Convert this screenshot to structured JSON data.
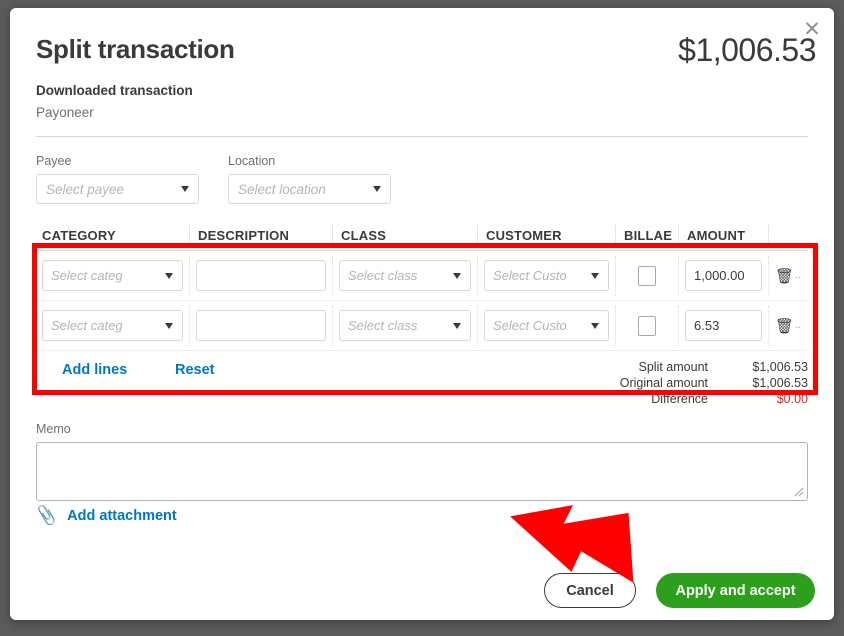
{
  "modal": {
    "title": "Split transaction",
    "total_amount": "$1,006.53",
    "close_icon": "close-icon",
    "downloaded_label": "Downloaded transaction",
    "downloaded_value": "Payoneer"
  },
  "fields": {
    "payee": {
      "label": "Payee",
      "placeholder": "Select payee",
      "value": ""
    },
    "location": {
      "label": "Location",
      "placeholder": "Select location",
      "value": ""
    }
  },
  "table": {
    "headers": [
      "CATEGORY",
      "DESCRIPTION",
      "CLASS",
      "CUSTOMER",
      "BILLAE",
      "AMOUNT",
      ""
    ],
    "placeholders": {
      "category": "Select categ",
      "description": "",
      "class": "Select class",
      "customer": "Select Custo"
    },
    "rows": [
      {
        "category": "",
        "description": "",
        "class": "",
        "customer": "",
        "billable": false,
        "amount": "1,000.00",
        "delete_icon": "trash-icon",
        "delete_more": ".."
      },
      {
        "category": "",
        "description": "",
        "class": "",
        "customer": "",
        "billable": false,
        "amount": "6.53",
        "delete_icon": "trash-icon",
        "delete_more": ".."
      }
    ]
  },
  "actions": {
    "add_lines": "Add lines",
    "reset": "Reset"
  },
  "totals": [
    {
      "label": "Split amount",
      "value": "$1,006.53",
      "negative": false
    },
    {
      "label": "Original amount",
      "value": "$1,006.53",
      "negative": false
    },
    {
      "label": "Difference",
      "value": "$0.00",
      "negative": true
    }
  ],
  "memo": {
    "label": "Memo",
    "value": "",
    "placeholder": ""
  },
  "attachment": {
    "label": "Add attachment",
    "icon": "paperclip-icon"
  },
  "footer": {
    "cancel": "Cancel",
    "apply": "Apply and accept"
  },
  "annotations": {
    "highlight_rect_color": "#ff0000",
    "arrow_color": "#ff0000"
  },
  "background": {
    "ghost_char": "c"
  },
  "colors": {
    "accent_link": "#0077c5",
    "primary_button": "#2ca01c",
    "text": "#393a3d",
    "muted": "#6b6f76",
    "negative": "#d52b1e",
    "backdrop": "#5c5c5c"
  }
}
